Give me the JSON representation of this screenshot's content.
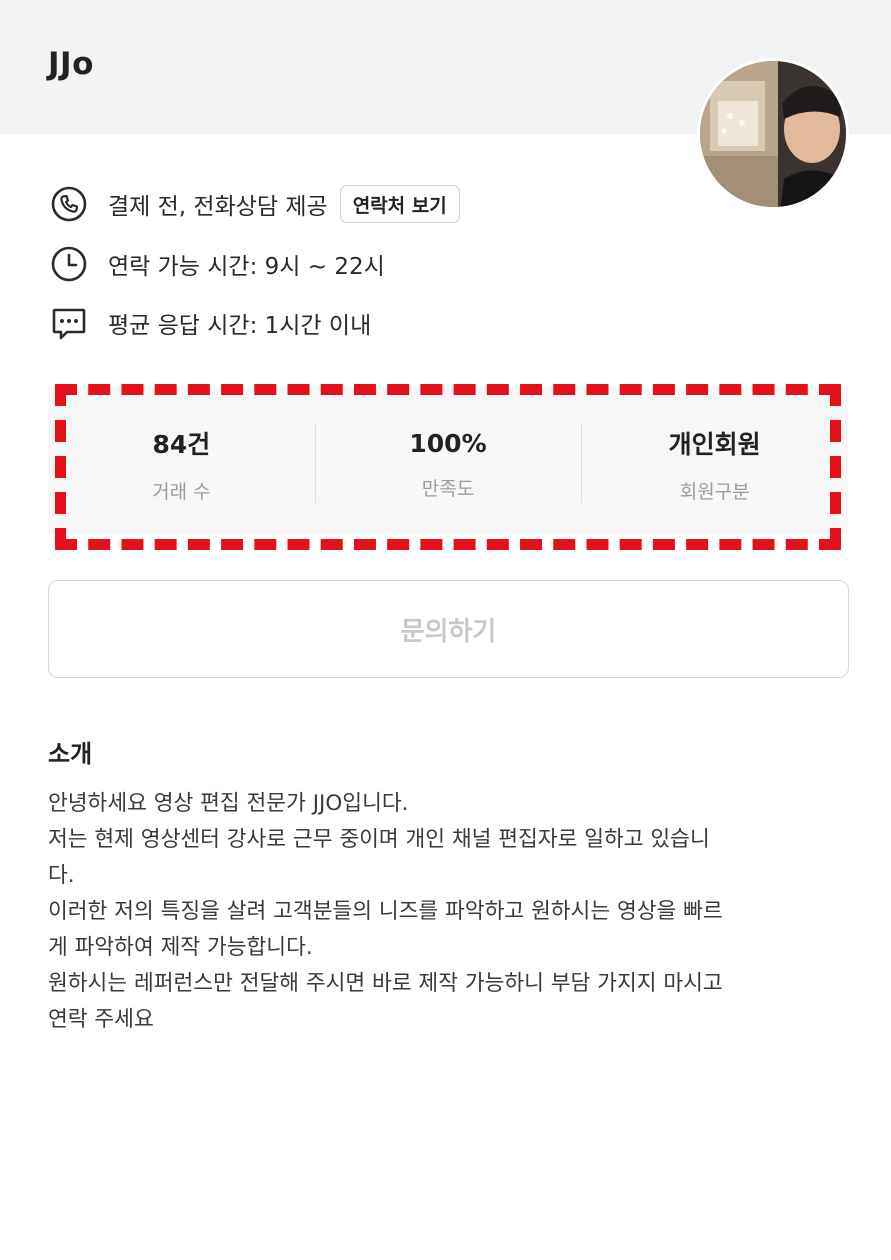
{
  "profile": {
    "name": "JJo",
    "avatar_alt": "profile photo"
  },
  "info": {
    "consult_text": "결제 전, 전화상담 제공",
    "contact_button": "연락처 보기",
    "contact_hours": "연락 가능 시간: 9시 ~ 22시",
    "avg_response": "평균 응답 시간: 1시간 이내"
  },
  "stats": [
    {
      "value": "84건",
      "label": "거래 수"
    },
    {
      "value": "100%",
      "label": "만족도"
    },
    {
      "value": "개인회원",
      "label": "회원구분"
    }
  ],
  "inquiry_button": "문의하기",
  "intro": {
    "title": "소개",
    "lines": [
      "안녕하세요 영상 편집 전문가 JJO입니다.",
      "저는 현제 영상센터 강사로 근무 중이며 개인 채널 편집자로 일하고 있습니",
      "다.",
      "이러한 저의 특징을 살려 고객분들의 니즈를 파악하고 원하시는 영상을 빠르",
      "게 파악하여 제작 가능합니다.",
      "원하시는 레퍼런스만 전달해 주시면 바로 제작 가능하니 부담 가지지 마시고",
      "연락 주세요"
    ]
  },
  "colors": {
    "highlight": "#e4101b",
    "header_bg": "#f2f3f5",
    "stats_bg": "#f7f7f8"
  },
  "icons": [
    "phone-icon",
    "clock-icon",
    "chat-icon"
  ]
}
